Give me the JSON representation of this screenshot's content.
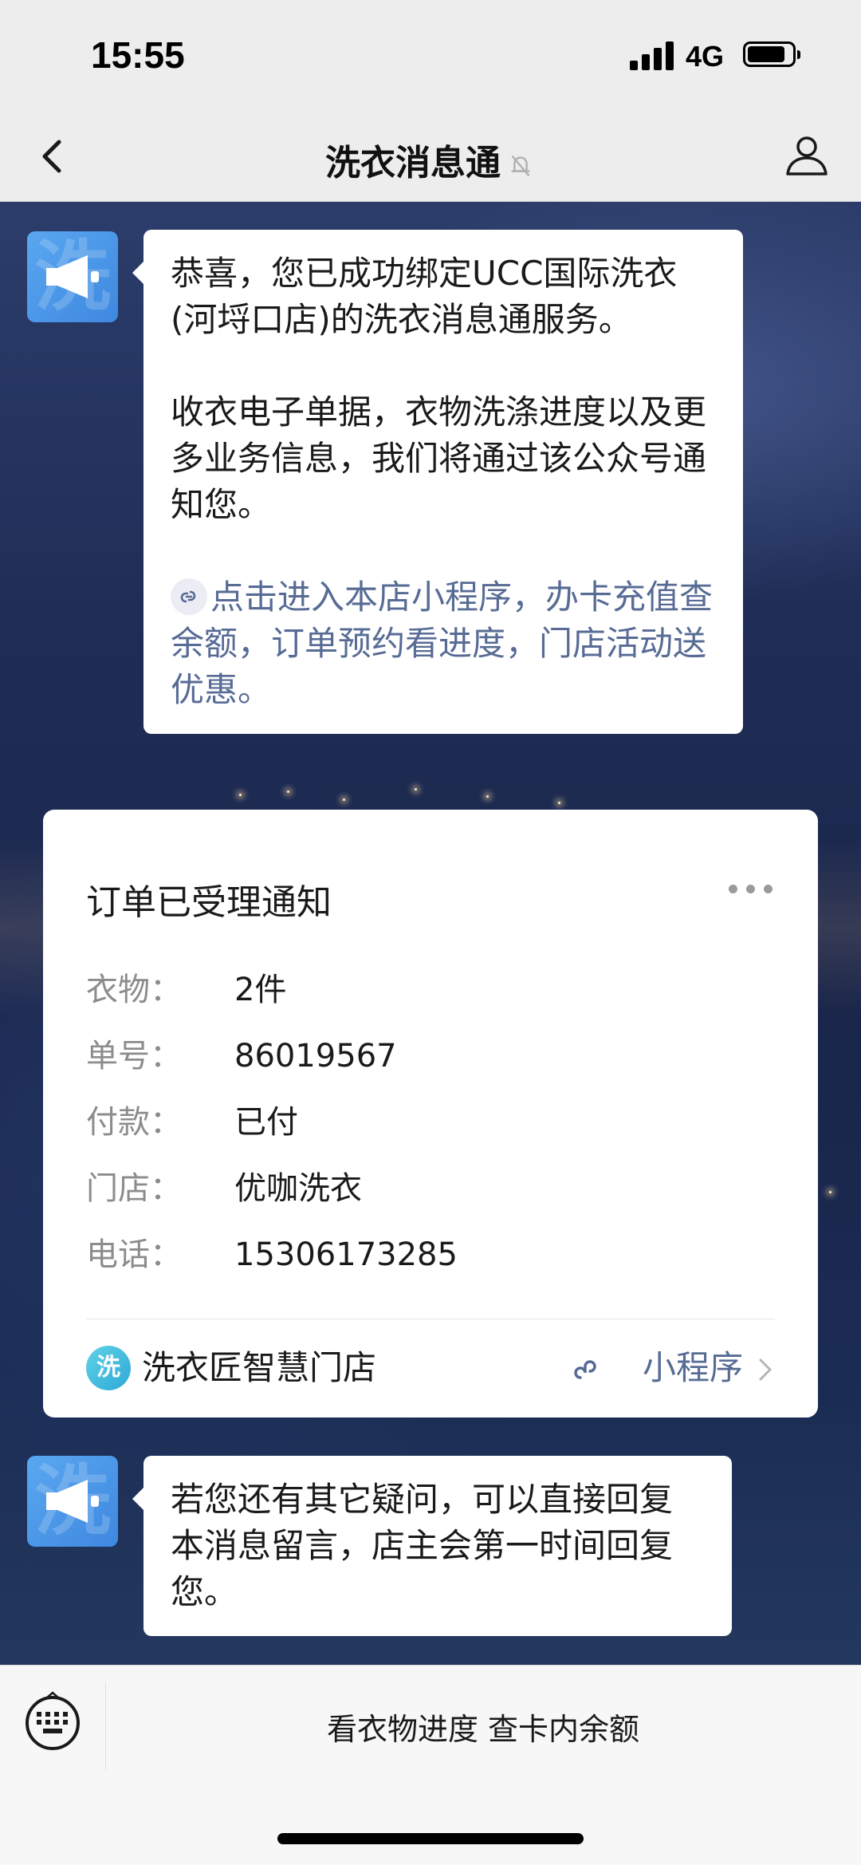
{
  "status_bar": {
    "time": "15:55",
    "network": "4G"
  },
  "nav": {
    "title": "洗衣消息通"
  },
  "messages": [
    {
      "paragraphs": [
        "恭喜，您已成功绑定UCC国际洗衣(河埒口店)的洗衣消息通服务。",
        "收衣电子单据，衣物洗涤进度以及更多业务信息，我们将通过该公众号通知您。"
      ],
      "link_text": "点击进入本店小程序，办卡充值查余额，订单预约看进度，门店活动送优惠。"
    },
    {
      "paragraphs": [
        "若您还有其它疑问，可以直接回复本消息留言，店主会第一时间回复您。"
      ]
    }
  ],
  "avatar_watermark": "洗",
  "card": {
    "title": "订单已受理通知",
    "fields": [
      {
        "label": "衣物：",
        "value": "2件"
      },
      {
        "label": "单号：",
        "value": "86019567"
      },
      {
        "label": "付款：",
        "value": "已付"
      },
      {
        "label": "门店：",
        "value": "优咖洗衣"
      },
      {
        "label": "电话：",
        "value": "15306173285"
      }
    ],
    "footer_logo_char": "洗",
    "footer_name": "洗衣匠智慧门店",
    "footer_mini_label": "小程序"
  },
  "bottom_menu": {
    "item": "看衣物进度 查卡内余额"
  },
  "colors": {
    "link": "#576b95",
    "avatar": "#4a95e8",
    "bar_bg": "#ededed"
  }
}
